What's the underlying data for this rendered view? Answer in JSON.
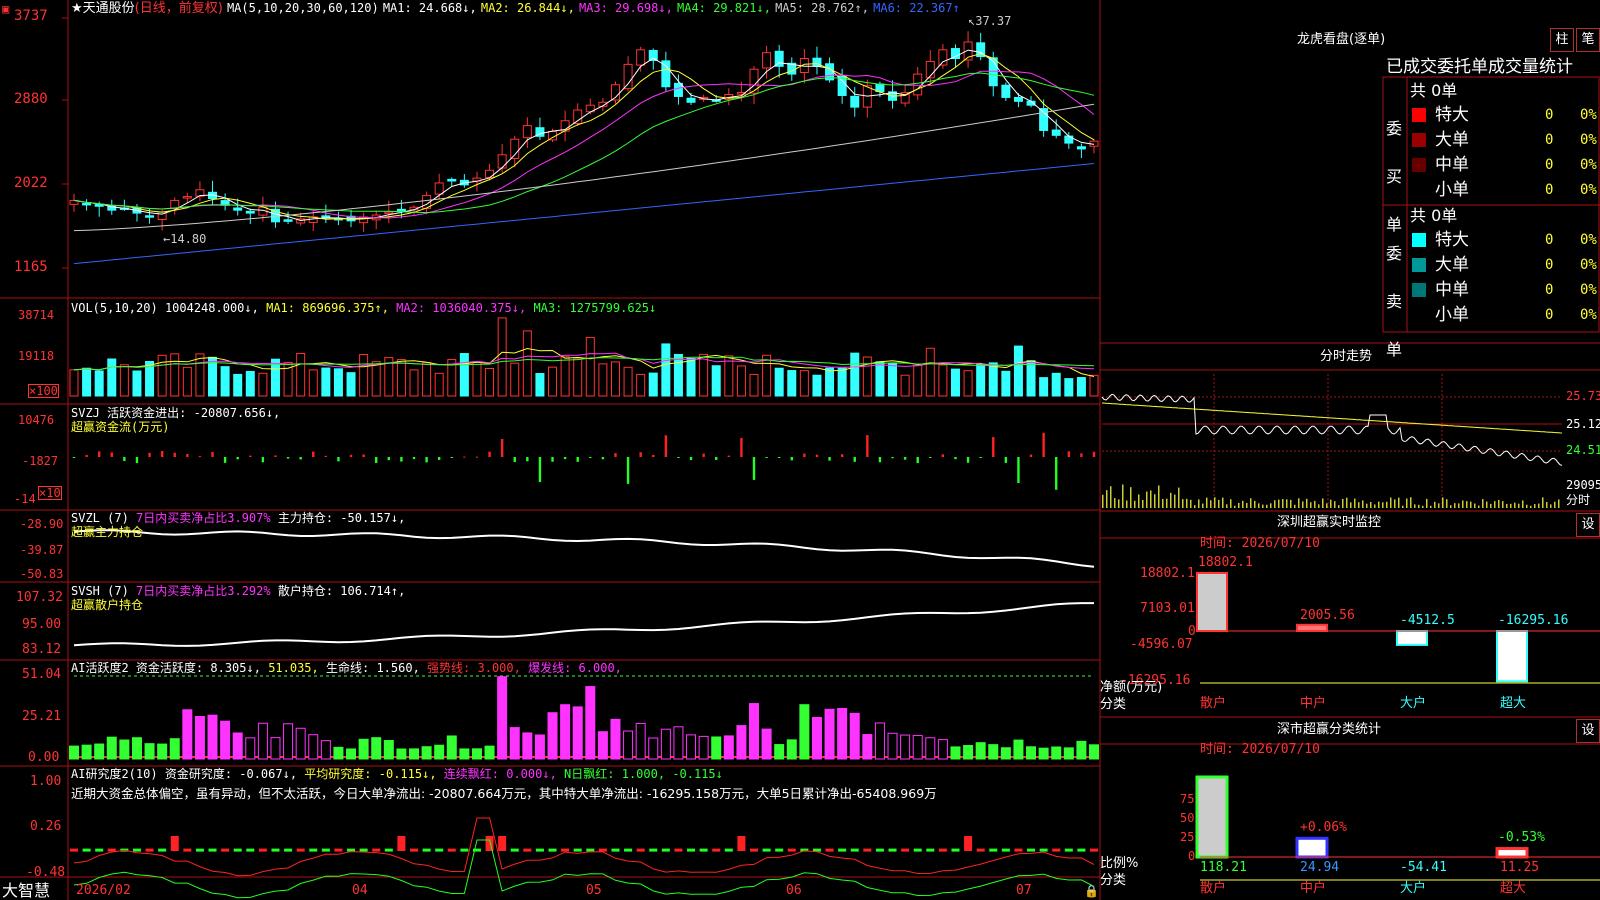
{
  "colors": {
    "up": "#ff3333",
    "down": "#33ffff",
    "frame": "#aa1111",
    "ma1": "#ffffff",
    "ma2": "#ffff33",
    "ma3": "#ff33ff",
    "ma4": "#33ff33",
    "ma5": "#cccccc",
    "ma6": "#3366ff"
  },
  "brand": "大智慧",
  "price_panel": {
    "header": {
      "stock": "★天通股份",
      "period": "(日线，前复权)",
      "ma_spec": "MA(5,10,20,30,60,120)",
      "ma1": "MA1: 24.668↓,",
      "ma2": "MA2: 26.844↓,",
      "ma3": "MA3: 29.698↓,",
      "ma4": "MA4: 29.821↓,",
      "ma5": "MA5: 28.762↑,",
      "ma6": "MA6: 22.367↑"
    },
    "y_labels": [
      "3737",
      "2880",
      "2022",
      "1165"
    ],
    "high_mark": "37.37",
    "low_mark": "14.80"
  },
  "vol_panel": {
    "header": {
      "spec": "VOL(5,10,20)",
      "vol": "1004248.000↓,",
      "ma1": "MA1: 869696.375↑,",
      "ma2": "MA2: 1036040.375↓,",
      "ma3": "MA3: 1275799.625↓"
    },
    "y_labels": [
      "38714",
      "19118",
      "×100"
    ]
  },
  "svzj_panel": {
    "header": {
      "spec": "SVZJ",
      "val": "活跃资金进出: -20807.656↓,",
      "title": "超赢资金流(万元)"
    },
    "y_labels": [
      "10476",
      "-1827",
      "-14",
      "×10"
    ]
  },
  "svzl_panel": {
    "header": {
      "spec": "SVZL (7)",
      "ratio": "7日内买卖净占比3.907%",
      "pos": "主力持仓: -50.157↓,",
      "title": "超赢主力持仓"
    },
    "y_labels": [
      "-28.90",
      "-39.87",
      "-50.83"
    ]
  },
  "svsh_panel": {
    "header": {
      "spec": "SVSH (7)",
      "ratio": "7日内买卖净占比3.292%",
      "pos": "散户持仓: 106.714↑,",
      "title": "超赢散户持仓"
    },
    "y_labels": [
      "107.32",
      "95.00",
      "83.12"
    ]
  },
  "ai1_panel": {
    "header": {
      "spec": "AI活跃度2",
      "a": "资金活跃度: 8.305↓,",
      "b": "51.035,",
      "c": "生命线: 1.560,",
      "d": "强势线: 3.000,",
      "e": "爆发线: 6.000,"
    },
    "y_labels": [
      "51.04",
      "25.21",
      "0.00"
    ]
  },
  "ai2_panel": {
    "header": {
      "spec": "AI研究度2(10)",
      "a": "资金研究度: -0.067↓,",
      "b": "平均研究度: -0.115↓,",
      "c": "连续飘红: 0.000↓,",
      "d": "N日飘红: 1.000, -0.115↓"
    },
    "comment": "近期大资金总体偏空，虽有异动，但不太活跃，今日大单净流出: -20807.664万元，其中特大单净流出: -16295.158万元，大单5日累计净出-65408.969万",
    "y_labels": [
      "1.00",
      "0.26",
      "-0.48"
    ]
  },
  "x_axis": [
    "2026/02",
    "04",
    "05",
    "06",
    "07"
  ],
  "dragon": {
    "title": "龙虎看盘(逐单)",
    "btn1": "柱",
    "btn2": "笔",
    "subtitle": "已成交委托单成交量统计",
    "buy": {
      "label": "委买单",
      "total": "共 0单",
      "rows": [
        {
          "name": "特大",
          "count": "0",
          "pct": "0%",
          "color": "#ff0000"
        },
        {
          "name": "大单",
          "count": "0",
          "pct": "0%",
          "color": "#990000"
        },
        {
          "name": "中单",
          "count": "0",
          "pct": "0%",
          "color": "#660000"
        },
        {
          "name": "小单",
          "count": "0",
          "pct": "0%",
          "color": ""
        }
      ]
    },
    "sell": {
      "label": "委卖单",
      "total": "共 0单",
      "rows": [
        {
          "name": "特大",
          "count": "0",
          "pct": "0%",
          "color": "#00ffff"
        },
        {
          "name": "大单",
          "count": "0",
          "pct": "0%",
          "color": "#009999"
        },
        {
          "name": "中单",
          "count": "0",
          "pct": "0%",
          "color": "#007777"
        },
        {
          "name": "小单",
          "count": "0",
          "pct": "0%",
          "color": ""
        }
      ]
    }
  },
  "intraday": {
    "title": "分时走势",
    "y_labels": [
      "25.73",
      "25.12",
      "24.51",
      "29095",
      "分时"
    ]
  },
  "sz_monitor": {
    "title": "深圳超赢实时监控",
    "btn": "设",
    "time": "时间: 2026/07/10",
    "y_labels": [
      "18802.1",
      "7103.01",
      "0",
      "-4596.07",
      "-16295.16"
    ],
    "unit": "净额(万元)",
    "axis_title": "分类",
    "chart_data": {
      "type": "bar",
      "categories": [
        "散户",
        "中户",
        "大户",
        "超大"
      ],
      "values": [
        18802.1,
        2005.56,
        -4512.5,
        -16295.16
      ],
      "labels": [
        "18802.1",
        "2005.56",
        "-4512.5",
        "-16295.16"
      ],
      "ylim": [
        -16295.16,
        18802.1
      ]
    }
  },
  "sz_class": {
    "title": "深市超赢分类统计",
    "btn": "设",
    "time": "时间: 2026/07/10",
    "y_labels": [
      "75",
      "50",
      "25",
      "0"
    ],
    "unit": "比例%",
    "axis_title": "分类",
    "chart_data": {
      "type": "bar",
      "categories": [
        "散户",
        "中户",
        "大户",
        "超大"
      ],
      "values": [
        118.21,
        24.94,
        -54.41,
        11.25
      ],
      "labels": [
        "118.21",
        "24.94",
        "-54.41",
        "11.25"
      ],
      "annotations": [
        "",
        "+0.06%",
        "",
        "-0.53%"
      ],
      "ylim": [
        0,
        75
      ]
    }
  },
  "chart_data": {
    "type": "candlestick",
    "title": "★天通股份 (日线，前复权)",
    "x_labels": [
      "2026/02",
      "04",
      "05",
      "06",
      "07"
    ],
    "price_range": [
      11.65,
      37.37
    ],
    "high": 37.37,
    "low": 14.8,
    "ma_values": {
      "MA1": 24.668,
      "MA2": 26.844,
      "MA3": 29.698,
      "MA4": 29.821,
      "MA5": 28.762,
      "MA6": 22.367
    },
    "close": [
      18.6,
      18.2,
      18.0,
      17.6,
      17.8,
      17.3,
      16.9,
      17.4,
      18.6,
      19.0,
      19.7,
      18.8,
      18.1,
      17.6,
      17.3,
      17.9,
      16.4,
      16.5,
      16.7,
      16.9,
      16.8,
      16.7,
      16.5,
      16.9,
      17.1,
      17.4,
      17.6,
      17.9,
      19.1,
      20.4,
      20.6,
      20.2,
      20.9,
      21.7,
      23.3,
      24.9,
      26.3,
      25.2,
      25.7,
      26.8,
      27.9,
      28.4,
      28.7,
      30.5,
      32.6,
      34.1,
      33.0,
      30.3,
      29.3,
      28.7,
      29.2,
      28.9,
      29.5,
      29.7,
      32.1,
      33.8,
      32.4,
      31.6,
      33.2,
      32.4,
      31.0,
      29.4,
      28.2,
      30.4,
      29.8,
      28.9,
      29.7,
      31.6,
      32.9,
      34.1,
      33.2,
      34.9,
      33.4,
      30.4,
      29.2,
      28.8,
      28.4,
      25.8,
      25.3,
      24.5,
      23.9,
      24.7
    ],
    "vol_range": [
      0,
      38714
    ],
    "svzj_range": [
      -14000,
      10476
    ],
    "svzl_range": [
      -50.83,
      -28.9
    ],
    "svsh_range": [
      83.12,
      107.32
    ],
    "ai1_range": [
      0.0,
      51.04
    ],
    "ai2_range": [
      -0.48,
      1.0
    ]
  }
}
